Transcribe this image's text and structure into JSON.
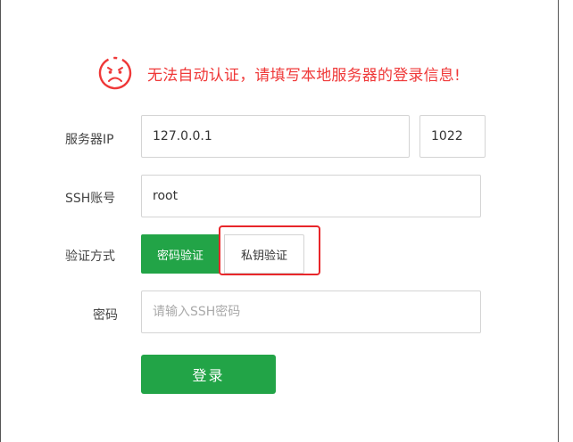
{
  "alert": {
    "icon": "sad-face-icon",
    "message": "无法自动认证，请填写本地服务器的登录信息!",
    "color": "#ef3838"
  },
  "form": {
    "server_ip": {
      "label": "服务器IP",
      "value": "127.0.0.1",
      "port_value": "1022"
    },
    "ssh_account": {
      "label": "SSH账号",
      "value": "root"
    },
    "auth_method": {
      "label": "验证方式",
      "options": [
        "密码验证",
        "私钥验证"
      ],
      "selected": "密码验证"
    },
    "password": {
      "label": "密码",
      "placeholder": "请输入SSH密码",
      "value": ""
    },
    "submit_label": "登录"
  },
  "colors": {
    "primary_green": "#22a447",
    "alert_red": "#ef3838",
    "highlight_red": "#e8262a"
  }
}
